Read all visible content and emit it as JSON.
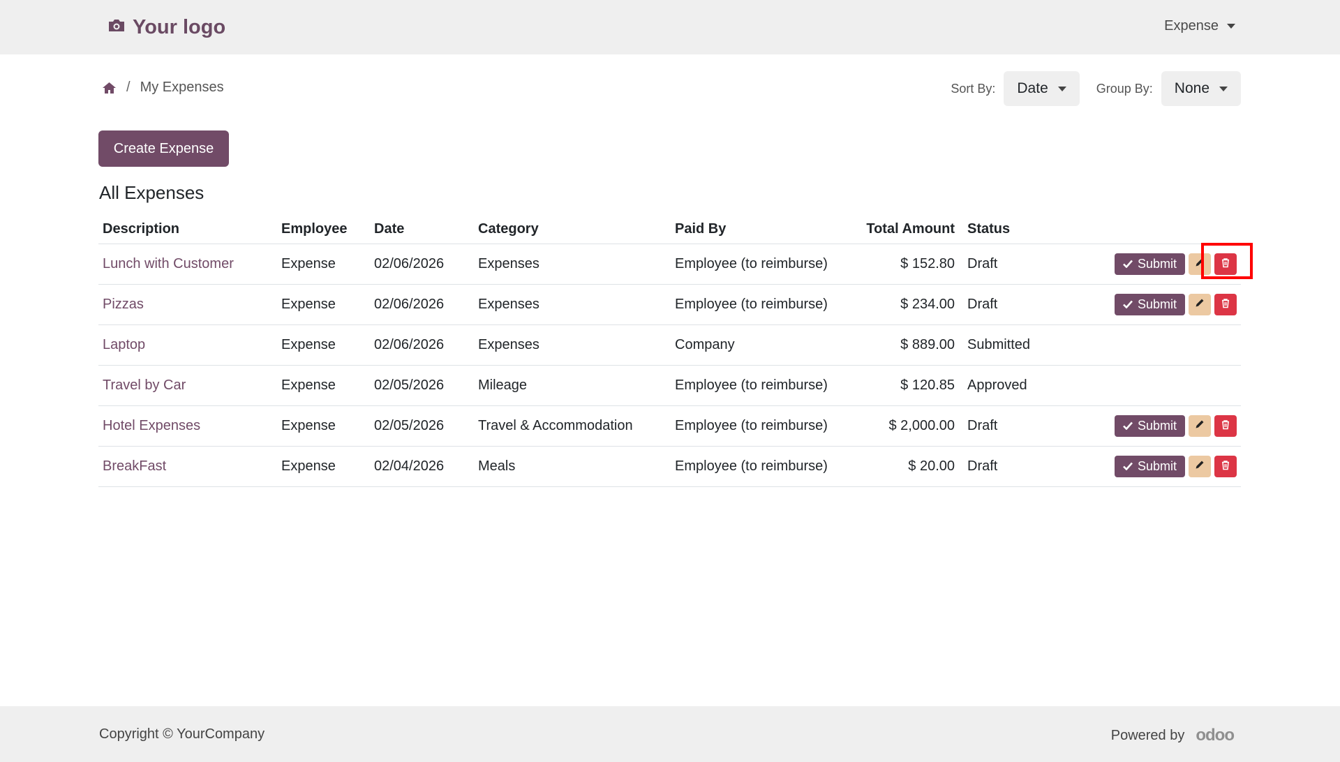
{
  "header": {
    "logo_text": "Your logo",
    "menu_label": "Expense"
  },
  "breadcrumb": {
    "current": "My Expenses"
  },
  "controls": {
    "sort_label": "Sort By:",
    "sort_value": "Date",
    "group_label": "Group By:",
    "group_value": "None"
  },
  "create_button_label": "Create Expense",
  "section_title": "All Expenses",
  "table": {
    "headers": [
      "Description",
      "Employee",
      "Date",
      "Category",
      "Paid By",
      "Total Amount",
      "Status"
    ],
    "rows": [
      {
        "description": "Lunch with Customer",
        "employee": "Expense",
        "date": "02/06/2026",
        "category": "Expenses",
        "paid_by": "Employee (to reimburse)",
        "amount": "$ 152.80",
        "status": "Draft",
        "submit": "Submit"
      },
      {
        "description": "Pizzas",
        "employee": "Expense",
        "date": "02/06/2026",
        "category": "Expenses",
        "paid_by": "Employee (to reimburse)",
        "amount": "$ 234.00",
        "status": "Draft",
        "submit": "Submit"
      },
      {
        "description": "Laptop",
        "employee": "Expense",
        "date": "02/06/2026",
        "category": "Expenses",
        "paid_by": "Company",
        "amount": "$ 889.00",
        "status": "Submitted"
      },
      {
        "description": "Travel by Car",
        "employee": "Expense",
        "date": "02/05/2026",
        "category": "Mileage",
        "paid_by": "Employee (to reimburse)",
        "amount": "$ 120.85",
        "status": "Approved"
      },
      {
        "description": "Hotel Expenses",
        "employee": "Expense",
        "date": "02/05/2026",
        "category": "Travel & Accommodation",
        "paid_by": "Employee (to reimburse)",
        "amount": "$ 2,000.00",
        "status": "Draft",
        "submit": "Submit"
      },
      {
        "description": "BreakFast",
        "employee": "Expense",
        "date": "02/04/2026",
        "category": "Meals",
        "paid_by": "Employee (to reimburse)",
        "amount": "$ 20.00",
        "status": "Draft",
        "submit": "Submit"
      }
    ]
  },
  "footer": {
    "copyright": "Copyright © YourCompany",
    "powered_by": "Powered by",
    "brand": "odoo"
  },
  "icons": {
    "logo": "camera-icon",
    "home": "home-icon",
    "submit": "check-icon",
    "edit": "pencil-icon",
    "delete": "trash-icon"
  },
  "colors": {
    "brand": "#714b67",
    "danger": "#dc3545",
    "warning": "#ecc9a2",
    "bar_background": "#efefef",
    "highlight": "#ff0000"
  }
}
